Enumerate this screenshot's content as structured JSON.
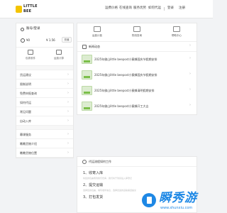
{
  "brand": {
    "line1": "LITTLE",
    "line2": "BEE"
  },
  "nav": [
    "运费价格",
    "在线查询",
    "服务优势",
    "如何代运",
    "登录",
    "注册"
  ],
  "account": {
    "login_text": "账号/登录",
    "coin_value": "¥0",
    "balance_label": "¥ 1.56",
    "recharge_label": "充值"
  },
  "quick": [
    {
      "label": "包裹收件",
      "icon": "box-icon"
    },
    {
      "label": "运费计算",
      "icon": "calculator-icon"
    }
  ],
  "menu": [
    "货运建议",
    "限制说明",
    "免费申报查询",
    "如何代运",
    "常见问题",
    "自动入库",
    "幕课服务",
    "瞧瞧货物介绍",
    "瞧瞧货物位置"
  ],
  "services": [
    {
      "label": "运费计费",
      "icon": "calc-icon"
    },
    {
      "label": "物流查询",
      "icon": "truck-icon"
    },
    {
      "label": "帮助中心",
      "icon": "help-icon"
    }
  ],
  "news": {
    "title": "新闻动态",
    "more": "›",
    "items": [
      "2025年佛山little beepost小蜜蜂国庆节假期安排",
      "2025年佛山little beepost小蜜蜂国庆节假期安排",
      "2025年佛山little beepost小蜜蜂清明假期安排",
      "2025年佛山little beepost小蜜蜂开工大吉"
    ]
  },
  "flow": {
    "title": "代运流程如何工作",
    "steps": [
      {
        "title": "1、收寄入库",
        "desc": "将您的包裹寄到我们仓库，我们将于到货后入库登记"
      },
      {
        "title": "2、提交运输",
        "desc": "选择您的包裹，填写收件信息，选择合适的运输渠道提交"
      },
      {
        "title": "3、打包发货",
        "desc": ""
      }
    ]
  },
  "watermark": {
    "big": "瞬秀游",
    "small": "www.shunxiu.com"
  }
}
